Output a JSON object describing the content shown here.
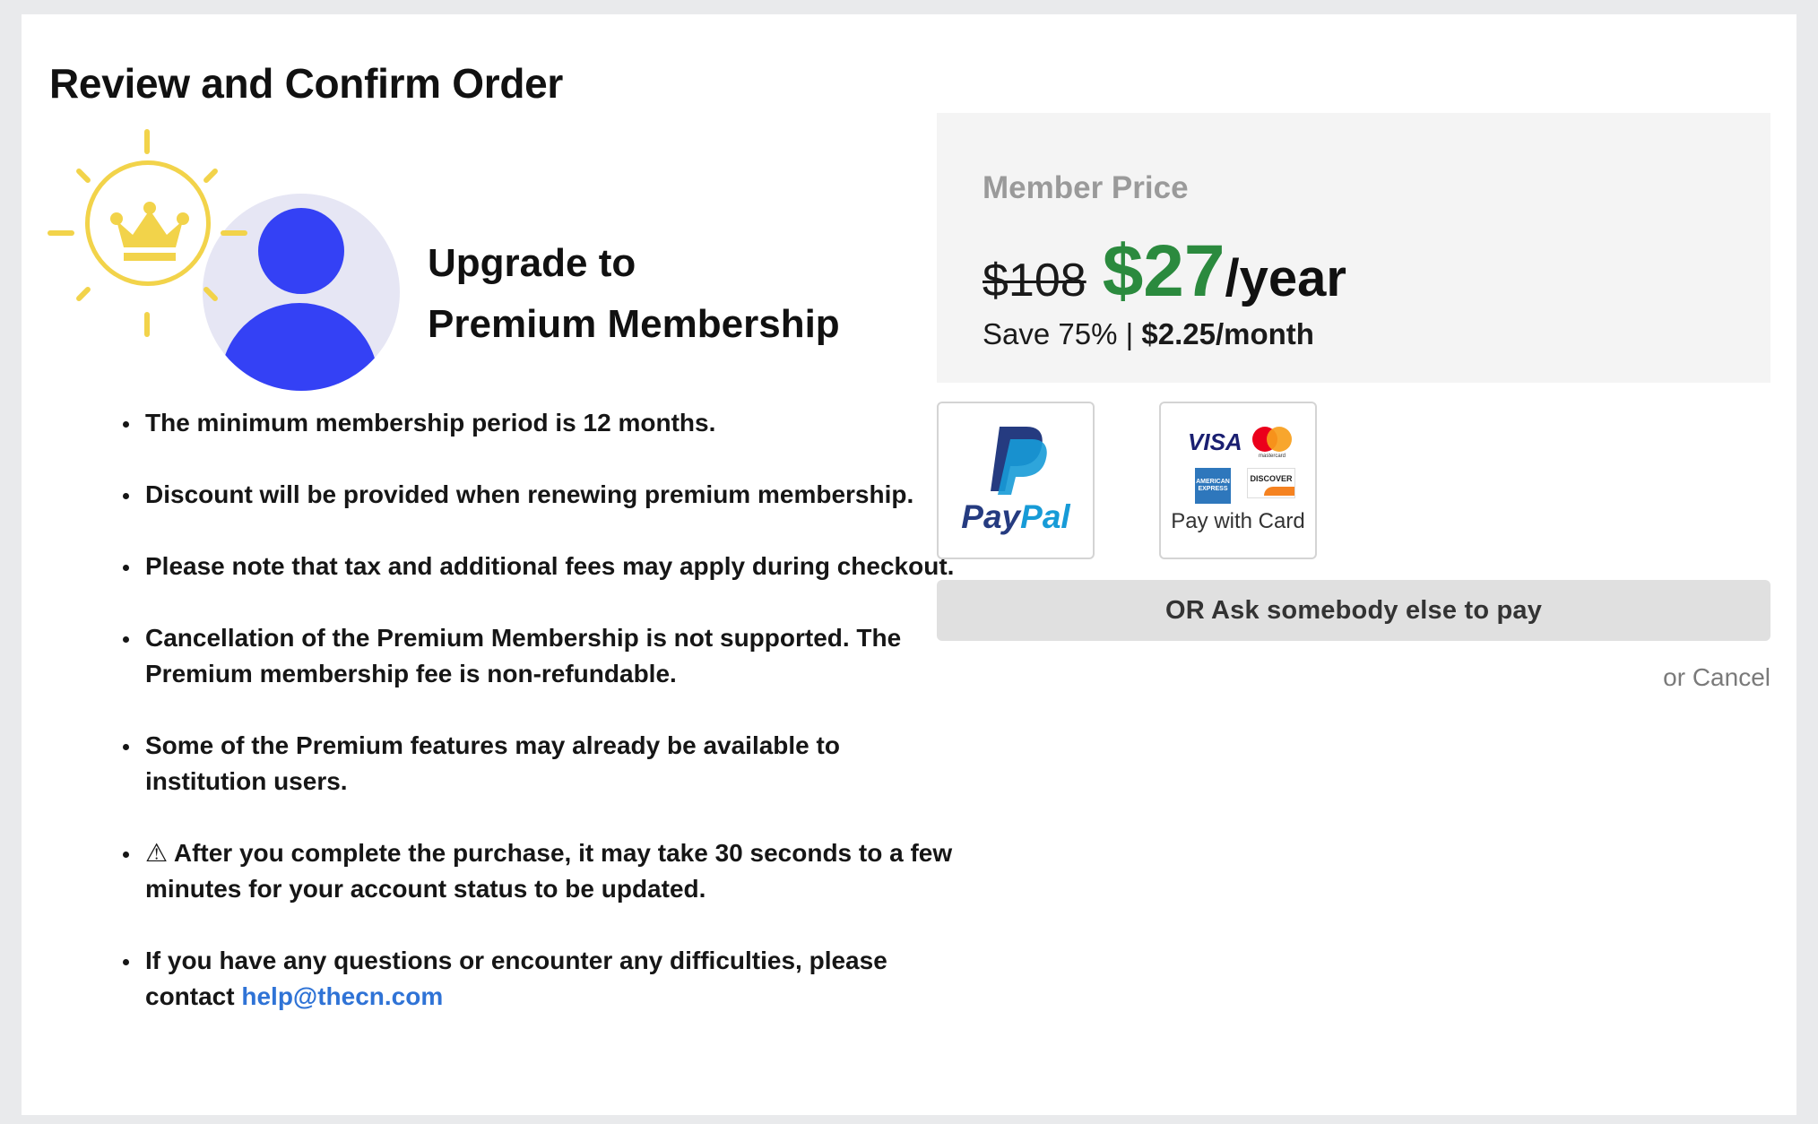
{
  "page": {
    "title": "Review and Confirm Order"
  },
  "hero": {
    "heading_line1": "Upgrade to",
    "heading_line2": "Premium Membership"
  },
  "notes": [
    "The minimum membership period is 12 months.",
    "Discount will be provided when renewing premium membership.",
    "Please note that tax and additional fees may apply during checkout.",
    "Cancellation of the Premium Membership is not supported. The Premium membership fee is non-refundable.",
    "Some of the Premium features may already be available to institution users.",
    "After you complete the purchase, it may take 30 seconds to a few minutes for your account status to be updated.",
    "If you have any questions or encounter any difficulties, please contact"
  ],
  "warning_icon": "⚠",
  "contact_email": "help@thecn.com",
  "price": {
    "label": "Member Price",
    "old_price": "$108",
    "new_price": "$27",
    "period": "/year",
    "save_text": "Save 75% |",
    "monthly": "$2.25/month"
  },
  "payment": {
    "paypal_wordmark_pay": "Pay",
    "paypal_wordmark_pal": "Pal",
    "card_visa": "VISA",
    "card_mastercard": "mastercard",
    "card_amex": "AMERICAN EXPRESS",
    "card_discover": "DISCOVER",
    "card_label": "Pay with Card",
    "ask_label": "OR Ask somebody else to pay",
    "cancel_label": "or Cancel"
  },
  "colors": {
    "accent_green": "#2b8a3e",
    "avatar_blue": "#3441f5",
    "crown_gold": "#f2d34a",
    "link_blue": "#2f73d6"
  },
  "icons": {
    "crown": "crown-icon",
    "avatar": "user-avatar-icon",
    "warning": "warning-icon",
    "paypal": "paypal-logo",
    "cards": "credit-card-logos"
  }
}
